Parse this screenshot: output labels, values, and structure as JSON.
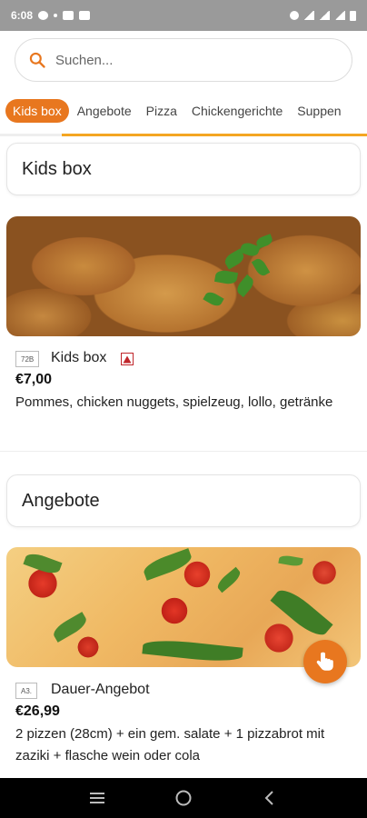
{
  "status_bar": {
    "time": "6:08"
  },
  "search": {
    "placeholder": "Suchen..."
  },
  "tabs": [
    {
      "label": "Kids box",
      "active": true
    },
    {
      "label": "Angebote",
      "active": false
    },
    {
      "label": "Pizza",
      "active": false
    },
    {
      "label": "Chickengerichte",
      "active": false
    },
    {
      "label": "Suppen",
      "active": false
    }
  ],
  "sections": [
    {
      "title": "Kids box",
      "item": {
        "code": "72B",
        "name": "Kids box",
        "price": "€7,00",
        "description": "Pommes, chicken nuggets, spielzeug, lollo, getränke"
      }
    },
    {
      "title": "Angebote",
      "item": {
        "code": "A3.",
        "name": "Dauer-Angebot",
        "price": "€26,99",
        "description": "2 pizzen (28cm) + ein gem. salate + 1 pizzabrot mit zaziki + flasche wein oder cola"
      }
    }
  ],
  "colors": {
    "accent": "#e8771f",
    "underline": "#f4a623",
    "allergen": "#c0262b"
  },
  "icons": {
    "search": "search-icon",
    "fab": "hand-pointer-icon",
    "allergen": "allergen-warning-icon"
  }
}
